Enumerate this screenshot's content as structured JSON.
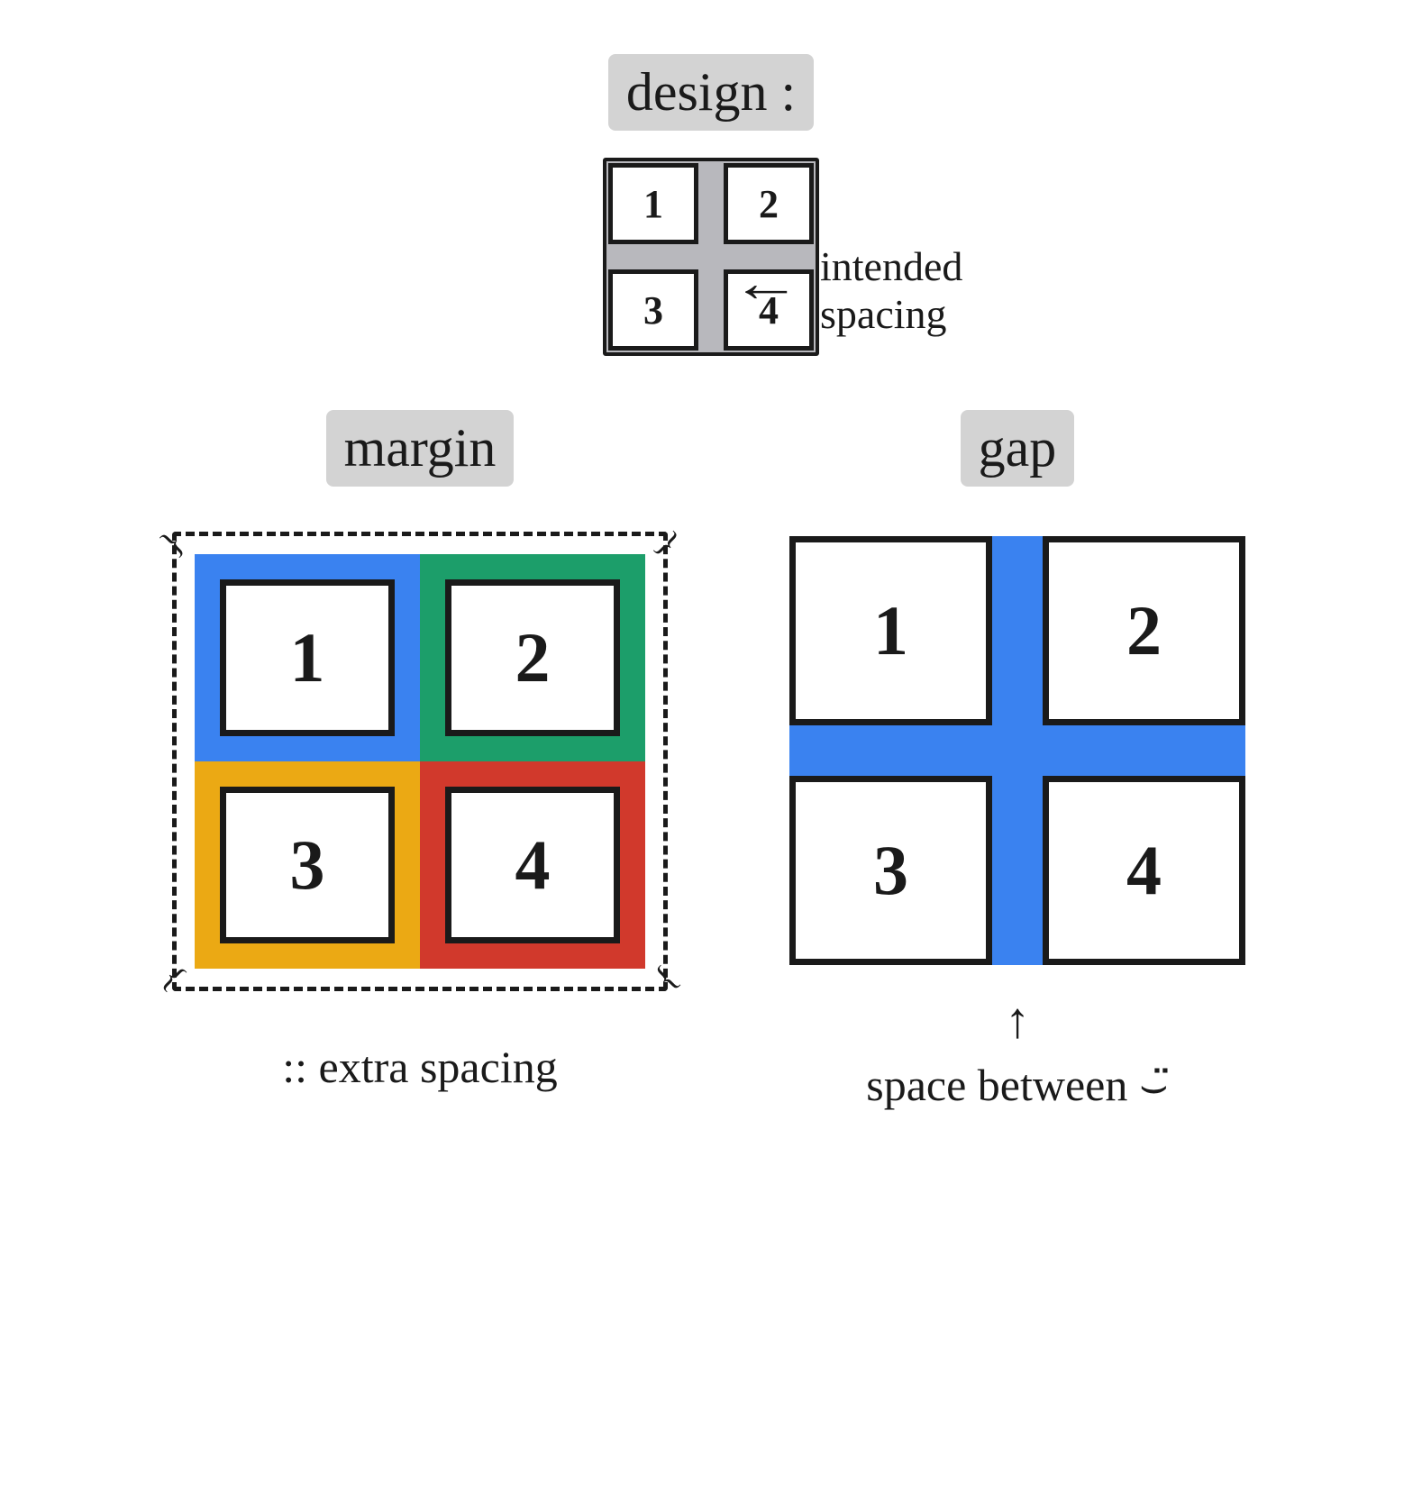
{
  "design": {
    "title": "design :",
    "cells": [
      "1",
      "2",
      "3",
      "4"
    ],
    "annotation": "intended\nspacing",
    "arrow": "←"
  },
  "margin": {
    "title": "margin",
    "cells": [
      "1",
      "2",
      "3",
      "4"
    ],
    "caption": ":: extra spacing"
  },
  "gap": {
    "title": "gap",
    "cells": [
      "1",
      "2",
      "3",
      "4"
    ],
    "arrow": "↑",
    "caption": "space between ⌣̈"
  },
  "colors": {
    "blue": "#3a82f0",
    "green": "#1c9e6a",
    "yellow": "#eba914",
    "red": "#d1392c",
    "highlight": "#d3d3d3"
  }
}
